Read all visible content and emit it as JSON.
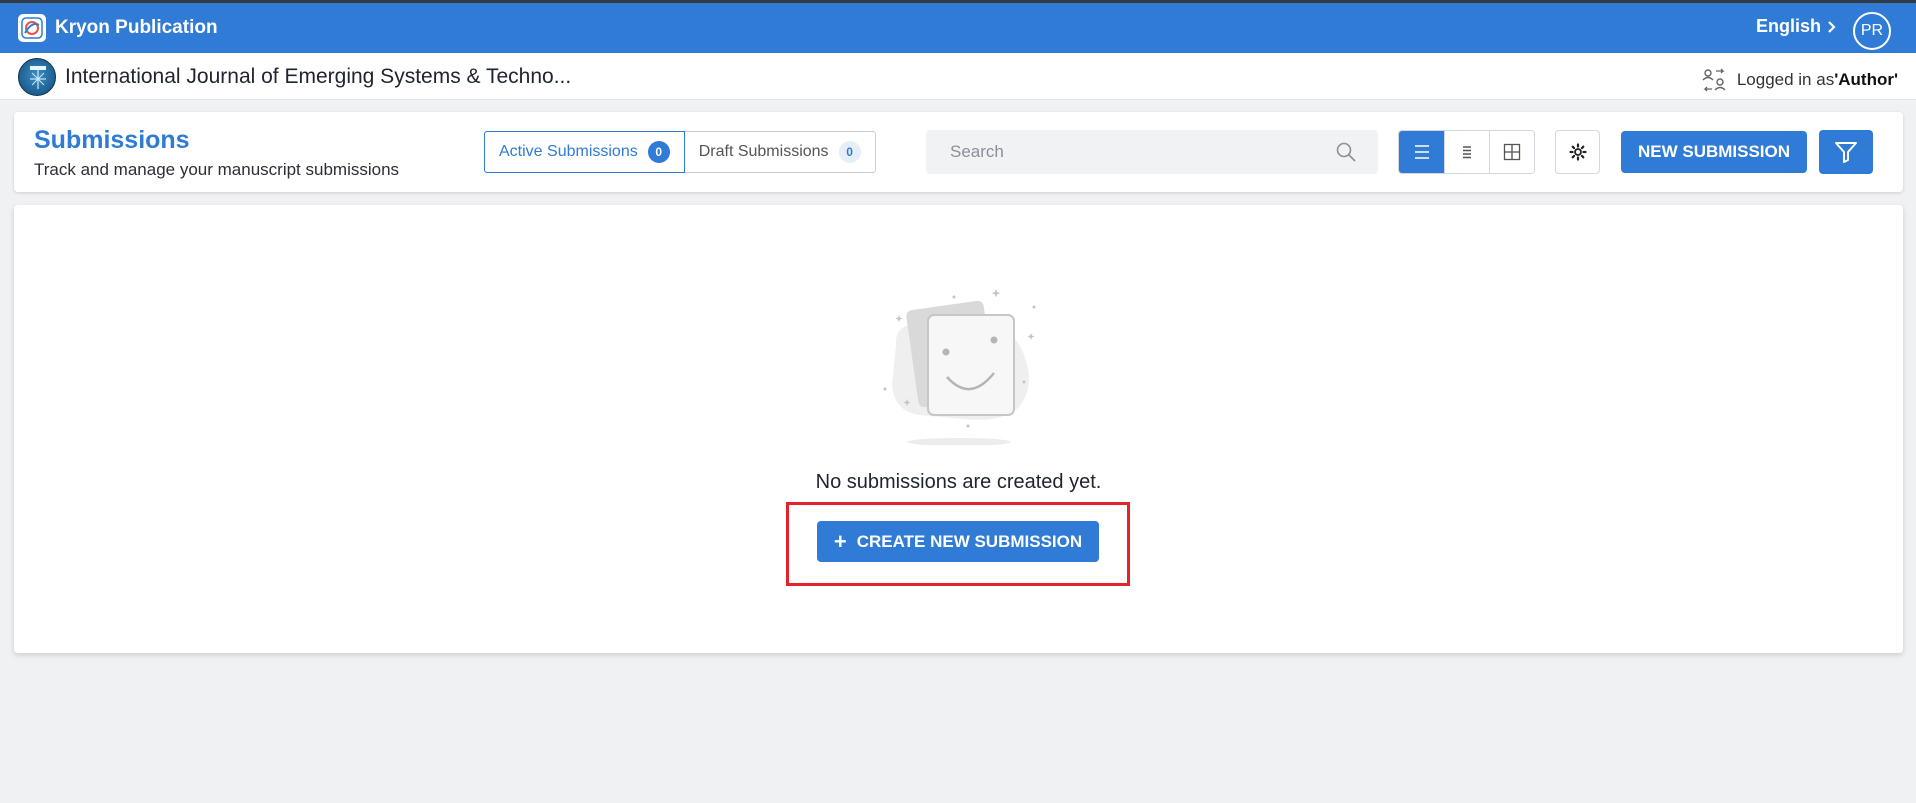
{
  "topbar": {
    "brand": "Kryon Publication",
    "language": "English",
    "avatar_initials": "PR",
    "bg_color": "#2f7bd5"
  },
  "journal": {
    "name": "International Journal of Emerging Systems & Techno...",
    "logged_in_prefix": "Logged in as ",
    "role": "'Author'"
  },
  "page": {
    "title": "Submissions",
    "subtitle": "Track and manage your manuscript submissions"
  },
  "tabs": [
    {
      "label": "Active Submissions",
      "count": "0",
      "active": true
    },
    {
      "label": "Draft Submissions",
      "count": "0",
      "active": false
    }
  ],
  "search": {
    "placeholder": "Search",
    "value": ""
  },
  "view_modes": [
    "list-view-icon",
    "compact-list-icon",
    "grid-view-icon"
  ],
  "toolbar": {
    "new_submission_label": "NEW SUBMISSION"
  },
  "empty_state": {
    "message": "No submissions are created yet.",
    "create_label": "CREATE NEW SUBMISSION"
  },
  "colors": {
    "accent": "#2f7bd5",
    "highlight": "#e32329"
  }
}
